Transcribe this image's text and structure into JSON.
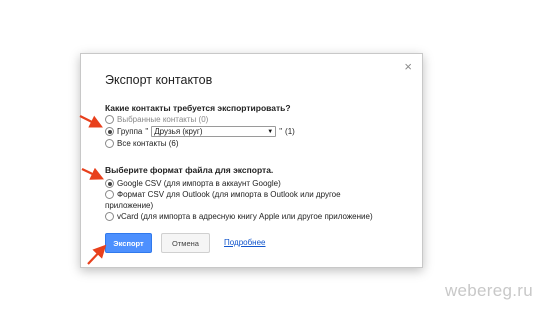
{
  "dialog": {
    "title": "Экспорт контактов",
    "close_glyph": "×",
    "section1": {
      "question": "Какие контакты требуется экспортировать?",
      "opt_selected": "Выбранные контакты (0)",
      "opt_group_label": "Группа",
      "opt_group_quote_open": "\"",
      "opt_group_value": "Друзья (круг)",
      "opt_group_quote_close": "\"",
      "opt_group_count": "(1)",
      "opt_all": "Все контакты (6)"
    },
    "section2": {
      "question": "Выберите формат файла для экспорта.",
      "opt_google": "Google CSV (для импорта в аккаунт Google)",
      "opt_outlook_line1": "Формат CSV для Outlook (для импорта в Outlook или другое",
      "opt_outlook_line2": "приложение)",
      "opt_vcard": "vCard (для импорта в адресную книгу Apple или другое приложение)"
    },
    "buttons": {
      "export": "Экспорт",
      "cancel": "Отмена",
      "more": "Подробнее"
    }
  },
  "watermark": "webereg.ru",
  "colors": {
    "primary_button": "#4d90fe",
    "link": "#1155cc",
    "annotation_arrow": "#e8401c"
  },
  "icons": {
    "close": "close-icon",
    "dropdown": "triangle-down-icon",
    "annotation": "red-arrow-icon"
  }
}
